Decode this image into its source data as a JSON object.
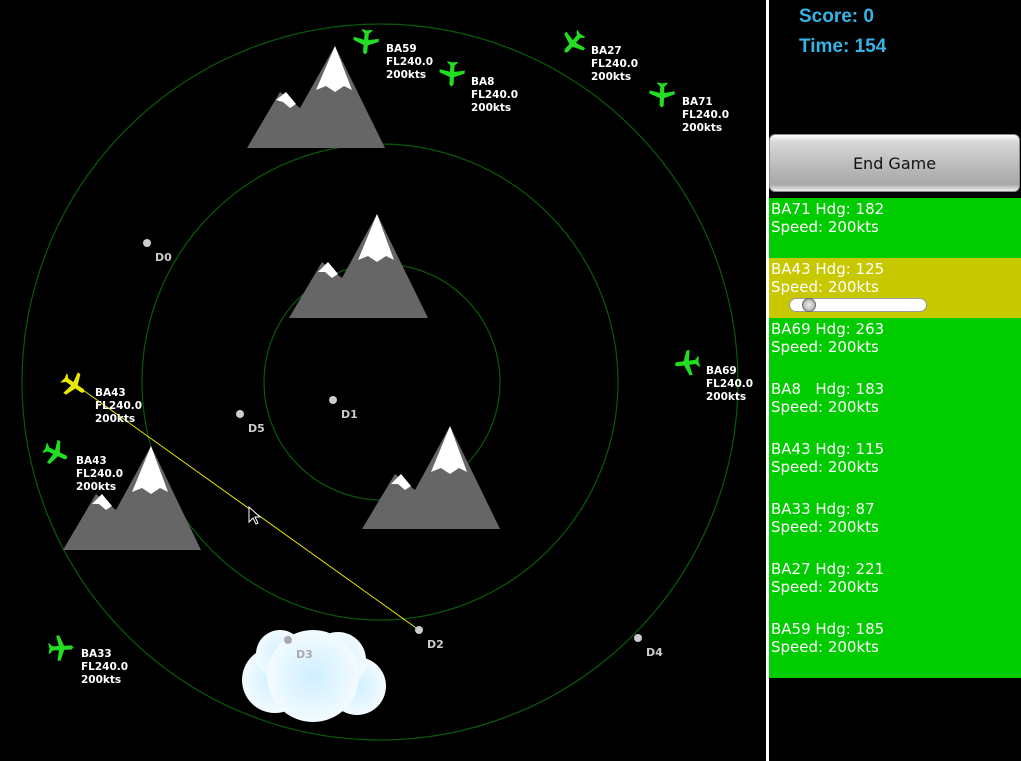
{
  "score": {
    "label": "Score: 0"
  },
  "time": {
    "label": "Time: 154"
  },
  "end_game": {
    "label": "End Game"
  },
  "waypoints": [
    "D0",
    "D1",
    "D2",
    "D3",
    "D4",
    "D5"
  ],
  "aircraft_labels": [
    {
      "callsign": "BA59",
      "level": "FL240.0",
      "speed": "200kts"
    },
    {
      "callsign": "BA8",
      "level": "FL240.0",
      "speed": "200kts"
    },
    {
      "callsign": "BA27",
      "level": "FL240.0",
      "speed": "200kts"
    },
    {
      "callsign": "BA71",
      "level": "FL240.0",
      "speed": "200kts"
    },
    {
      "callsign": "BA69",
      "level": "FL240.0",
      "speed": "200kts"
    },
    {
      "callsign": "BA43",
      "level": "FL240.0",
      "speed": "200kts"
    },
    {
      "callsign": "BA43",
      "level": "FL240.0",
      "speed": "200kts"
    },
    {
      "callsign": "BA33",
      "level": "FL240.0",
      "speed": "200kts"
    }
  ],
  "flights": [
    {
      "line1": "BA71 Hdg: 182",
      "line2": "Speed: 200kts"
    },
    {
      "line1": "BA43 Hdg: 125",
      "line2": "Speed: 200kts"
    },
    {
      "line1": "BA69 Hdg: 263",
      "line2": "Speed: 200kts"
    },
    {
      "line1": "BA8   Hdg: 183",
      "line2": "Speed: 200kts"
    },
    {
      "line1": "BA43 Hdg: 115",
      "line2": "Speed: 200kts"
    },
    {
      "line1": "BA33 Hdg: 87",
      "line2": "Speed: 200kts"
    },
    {
      "line1": "BA27 Hdg: 221",
      "line2": "Speed: 200kts"
    },
    {
      "line1": "BA59 Hdg: 185",
      "line2": "Speed: 200kts"
    }
  ],
  "colors": {
    "radar_ring": "#0a5a0a",
    "plane": "#22dd22",
    "plane_selected": "#e8e800",
    "list_bg": "#00cc00",
    "list_selected": "#c8c800",
    "score_text": "#33b5e5"
  }
}
